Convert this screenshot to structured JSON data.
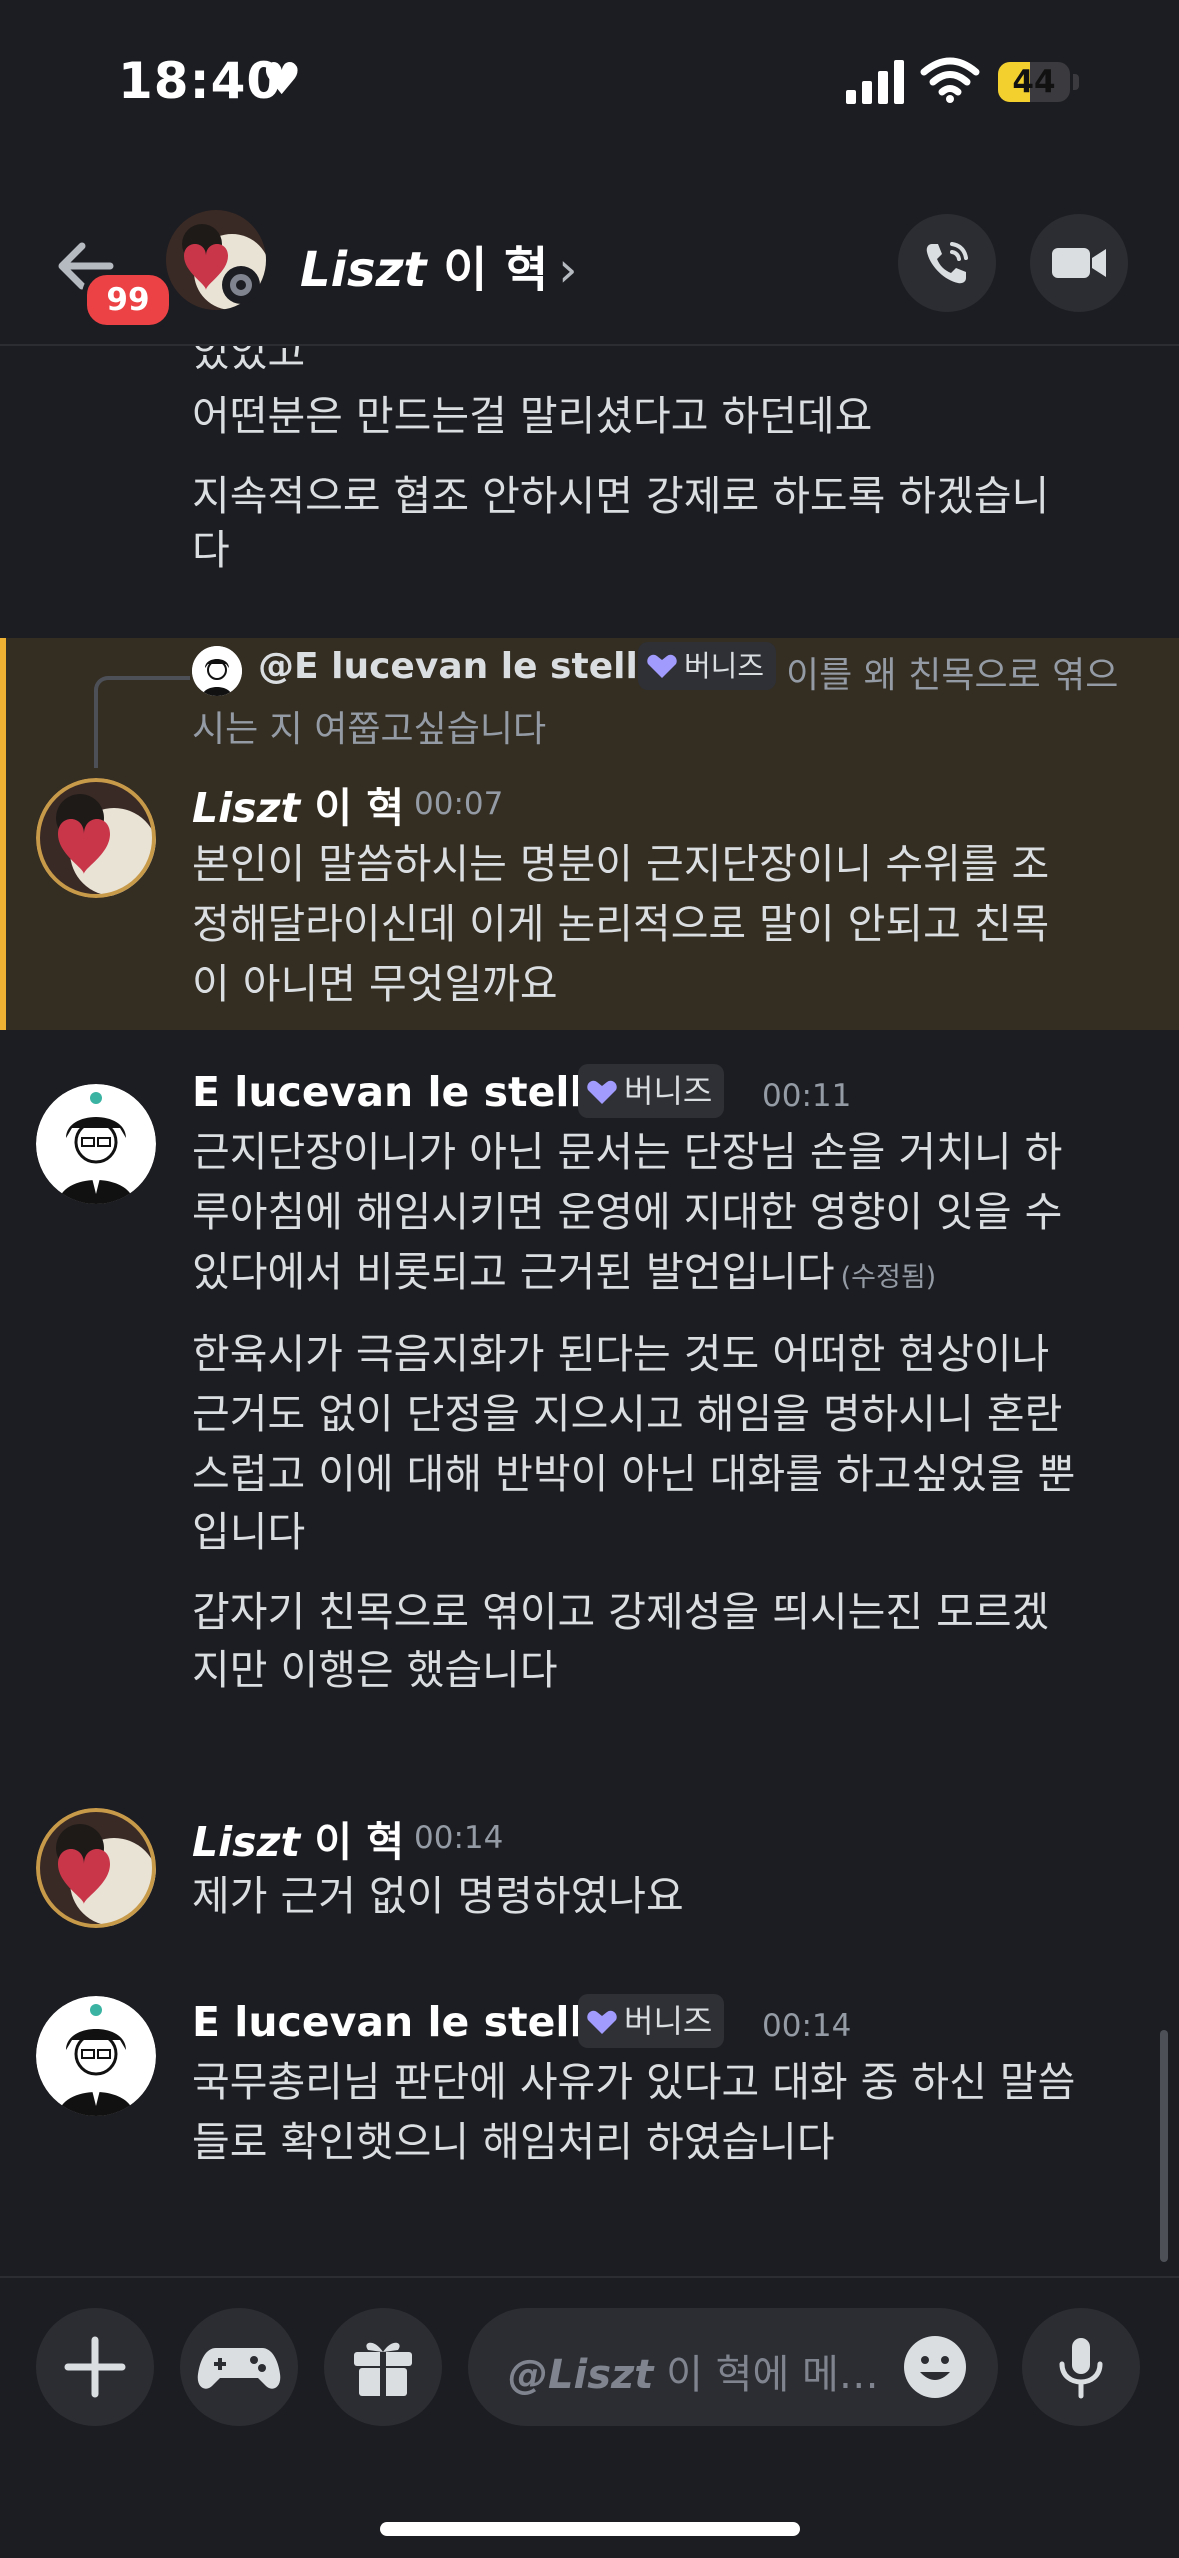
{
  "status_bar": {
    "time": "18:40",
    "battery": "44",
    "battery_level": 0.44
  },
  "header": {
    "unread_count": "99",
    "channel_name_italic": "Liszt",
    "channel_name_rest": " 이 혁",
    "chevron": "›"
  },
  "messages": {
    "prev": {
      "cut_line": "있었고",
      "lines": [
        "어떤분은 만드는걸 말리셨다고 하던데요",
        "지속적으로 협조 안하시면 강제로 하도록 하겠습니",
        "다"
      ]
    },
    "reply": {
      "mention": "@E lucevan le stelle",
      "tag": "버니즈",
      "text_line1": "이를 왜 친목으로 엮으",
      "text_line2": "시는 지 여쭙고싶습니다"
    },
    "m1": {
      "author_italic": "Liszt",
      "author_rest": " 이 혁",
      "time": "00:07",
      "lines": [
        "본인이 말씀하시는 명분이 근지단장이니 수위를 조",
        "정해달라이신데 이게 논리적으로 말이 안되고 친목",
        "이 아니면 무엇일까요"
      ]
    },
    "m2": {
      "author": "E lucevan le stelle",
      "tag": "버니즈",
      "time": "00:11",
      "lines": [
        "근지단장이니가 아닌 문서는 단장님 손을 거치니 하",
        "루아침에 해임시키면 운영에 지대한 영향이 잇을 수",
        "있다에서 비롯되고 근거된 발언입니다"
      ],
      "edited": "(수정됨)",
      "lines2": [
        "한육시가 극음지화가 된다는 것도 어떠한 현상이나",
        "근거도 없이 단정을 지으시고 해임을 명하시니 혼란",
        "스럽고 이에 대해 반박이 아닌 대화를 하고싶었을 뿐",
        "입니다"
      ],
      "lines3": [
        "갑자기 친목으로 엮이고 강제성을 띄시는진 모르겠",
        "지만 이행은 했습니다"
      ]
    },
    "m3": {
      "author_italic": "Liszt",
      "author_rest": " 이 혁",
      "time": "00:14",
      "lines": [
        "제가 근거 없이 명령하였나요"
      ]
    },
    "m4": {
      "author": "E lucevan le stelle",
      "tag": "버니즈",
      "time": "00:14",
      "lines": [
        "국무총리님 판단에 사유가 있다고 대화 중 하신 말씀",
        "들로 확인햇으니 해임처리 하였습니다"
      ]
    }
  },
  "composer": {
    "placeholder_italic": "@Liszt",
    "placeholder_rest": " 이 혁에 메…"
  },
  "icons": {
    "back": "back-arrow-icon",
    "call": "phone-call-icon",
    "video": "video-camera-icon",
    "plus": "plus-icon",
    "game": "gamepad-icon",
    "gift": "gift-icon",
    "emoji": "emoji-icon",
    "mic": "microphone-icon",
    "badge": "heart-gem-icon"
  },
  "colors": {
    "background": "#1c1d22",
    "highlight": "#332d22",
    "highlight_bar": "#f0b232",
    "unread_badge": "#ed4245",
    "battery": "#f4d02f"
  }
}
